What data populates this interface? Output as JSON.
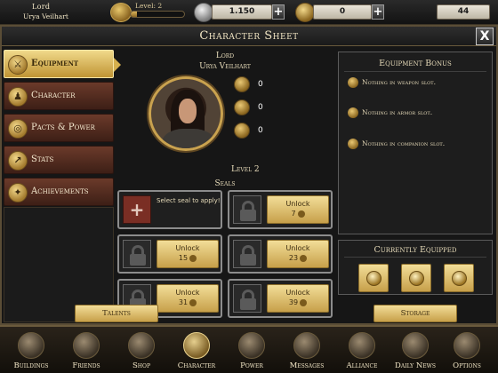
{
  "player": {
    "rank": "Lord",
    "name": "Urya Veilhart",
    "level_label": "Level: 2",
    "xp_fraction": 0.12
  },
  "resources": {
    "silver": "1.150",
    "gold": "0",
    "stat": "44"
  },
  "window": {
    "title": "Character Sheet",
    "close": "X"
  },
  "sidebar": {
    "items": [
      {
        "label": "Equipment"
      },
      {
        "label": "Character"
      },
      {
        "label": "Pacts & Power"
      },
      {
        "label": "Stats"
      },
      {
        "label": "Achievements"
      }
    ]
  },
  "character": {
    "rank": "Lord",
    "name": "Urya Veilhart",
    "level": "Level 2",
    "stats": [
      "0",
      "0",
      "0"
    ]
  },
  "seals": {
    "label": "Seals",
    "apply_text": "Select seal to apply!",
    "apply_plus": "+",
    "unlock_label": "Unlock",
    "costs": [
      "7",
      "15",
      "23",
      "31",
      "39"
    ]
  },
  "buttons": {
    "talents": "Talents",
    "storage": "Storage"
  },
  "equipment_bonus": {
    "title": "Equipment Bonus",
    "rows": [
      "Nothing in weapon slot.",
      "Nothing in armor slot.",
      "Nothing in companion slot."
    ]
  },
  "currently_equipped": {
    "title": "Currently Equipped"
  },
  "nav": {
    "items": [
      {
        "label": "Buildings"
      },
      {
        "label": "Friends"
      },
      {
        "label": "Shop"
      },
      {
        "label": "Character"
      },
      {
        "label": "Power"
      },
      {
        "label": "Messages"
      },
      {
        "label": "Alliance"
      },
      {
        "label": "Daily News"
      },
      {
        "label": "Options"
      }
    ]
  },
  "colors": {
    "accent_gold": "#c7a04a",
    "sidebar_red": "#6b3a2a",
    "background": "#161616"
  }
}
